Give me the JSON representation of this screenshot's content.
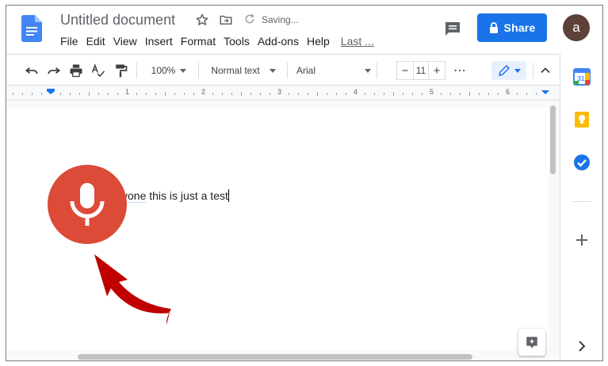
{
  "document": {
    "title": "Untitled document",
    "status": "Saving...",
    "body_text_underlined": "yone",
    "body_text_rest": " this is just a test"
  },
  "menubar": {
    "items": [
      "File",
      "Edit",
      "View",
      "Insert",
      "Format",
      "Tools",
      "Add-ons",
      "Help"
    ],
    "last_edit": "Last ..."
  },
  "header": {
    "share_label": "Share",
    "avatar_letter": "a"
  },
  "toolbar": {
    "zoom": "100%",
    "style": "Normal text",
    "font": "Arial",
    "font_size": "11",
    "minus": "−",
    "plus": "+",
    "more": "⋯"
  },
  "ruler": {
    "numbers": [
      "1",
      "2",
      "3",
      "4",
      "5",
      "6"
    ]
  },
  "colors": {
    "share": "#1a73e8",
    "mic": "#dc4a38",
    "arrow": "#c00000",
    "avatar": "#5d4037"
  },
  "icons": {
    "logo": "docs-logo",
    "star": "star-icon",
    "move": "move-to-folder-icon",
    "saving": "sync-icon",
    "comment": "comment-icon",
    "share_lock": "lock-icon",
    "mic": "microphone-icon",
    "calendar": "calendar-icon",
    "keep": "keep-icon",
    "tasks": "tasks-icon",
    "add": "add-icon",
    "expand": "chevron-right-icon",
    "explore": "explore-icon"
  }
}
